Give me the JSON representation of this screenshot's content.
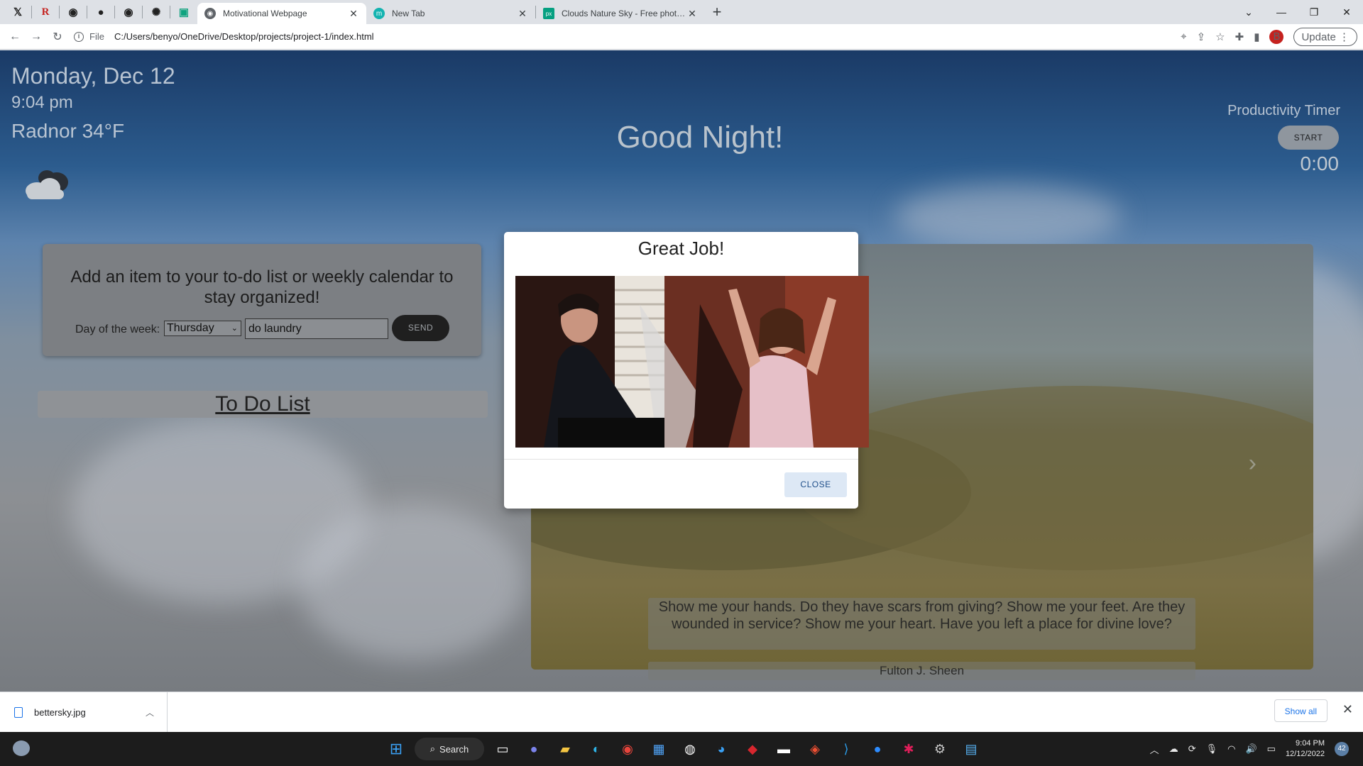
{
  "browser": {
    "pinned_tabs": [
      {
        "icon": "x-icon",
        "glyph": "X"
      },
      {
        "icon": "r-icon",
        "glyph": "R"
      },
      {
        "icon": "globe-icon",
        "glyph": "◉"
      },
      {
        "icon": "github-icon",
        "glyph": "●"
      },
      {
        "icon": "globe-icon",
        "glyph": "◉"
      },
      {
        "icon": "openai-icon",
        "glyph": "✺"
      },
      {
        "icon": "app-icon",
        "glyph": "▣"
      }
    ],
    "tabs": [
      {
        "title": "Motivational Webpage",
        "active": true,
        "icon": "globe-icon",
        "color": "#5f6368"
      },
      {
        "title": "New Tab",
        "active": false,
        "icon": "m-icon",
        "color": "#13b3b0"
      },
      {
        "title": "Clouds Nature Sky - Free photo o",
        "active": false,
        "icon": "px-icon",
        "color": "#05a081"
      }
    ],
    "address": {
      "scheme_label": "File",
      "url": "C:/Users/benyo/OneDrive/Desktop/projects/project-1/index.html"
    },
    "profile_initial": "B",
    "update_label": "Update"
  },
  "page": {
    "date": "Monday, Dec 12",
    "time": "9:04 pm",
    "weather": "Radnor 34°F",
    "greeting": "Good Night!",
    "timer": {
      "title": "Productivity Timer",
      "start_label": "START",
      "value": "0:00"
    },
    "todo_form": {
      "prompt": "Add an item to your to-do list or weekly calendar to stay organized!",
      "day_label": "Day of the week:",
      "day_selected": "Thursday",
      "task_value": "do laundry",
      "send_label": "SEND"
    },
    "todo_list_title": "To Do List",
    "carousel": {
      "quote": "Show me your hands. Do they have scars from giving? Show me your feet. Are they wounded in service? Show me your heart. Have you left a place for divine love?",
      "author": "Fulton J. Sheen",
      "slide_count": 10,
      "active_index": 2
    }
  },
  "modal": {
    "title": "Great Job!",
    "close_label": "CLOSE"
  },
  "download_shelf": {
    "filename": "bettersky.jpg",
    "show_all_label": "Show all"
  },
  "taskbar": {
    "search_label": "Search",
    "clock_time": "9:04 PM",
    "clock_date": "12/12/2022",
    "notification_count": "42"
  }
}
